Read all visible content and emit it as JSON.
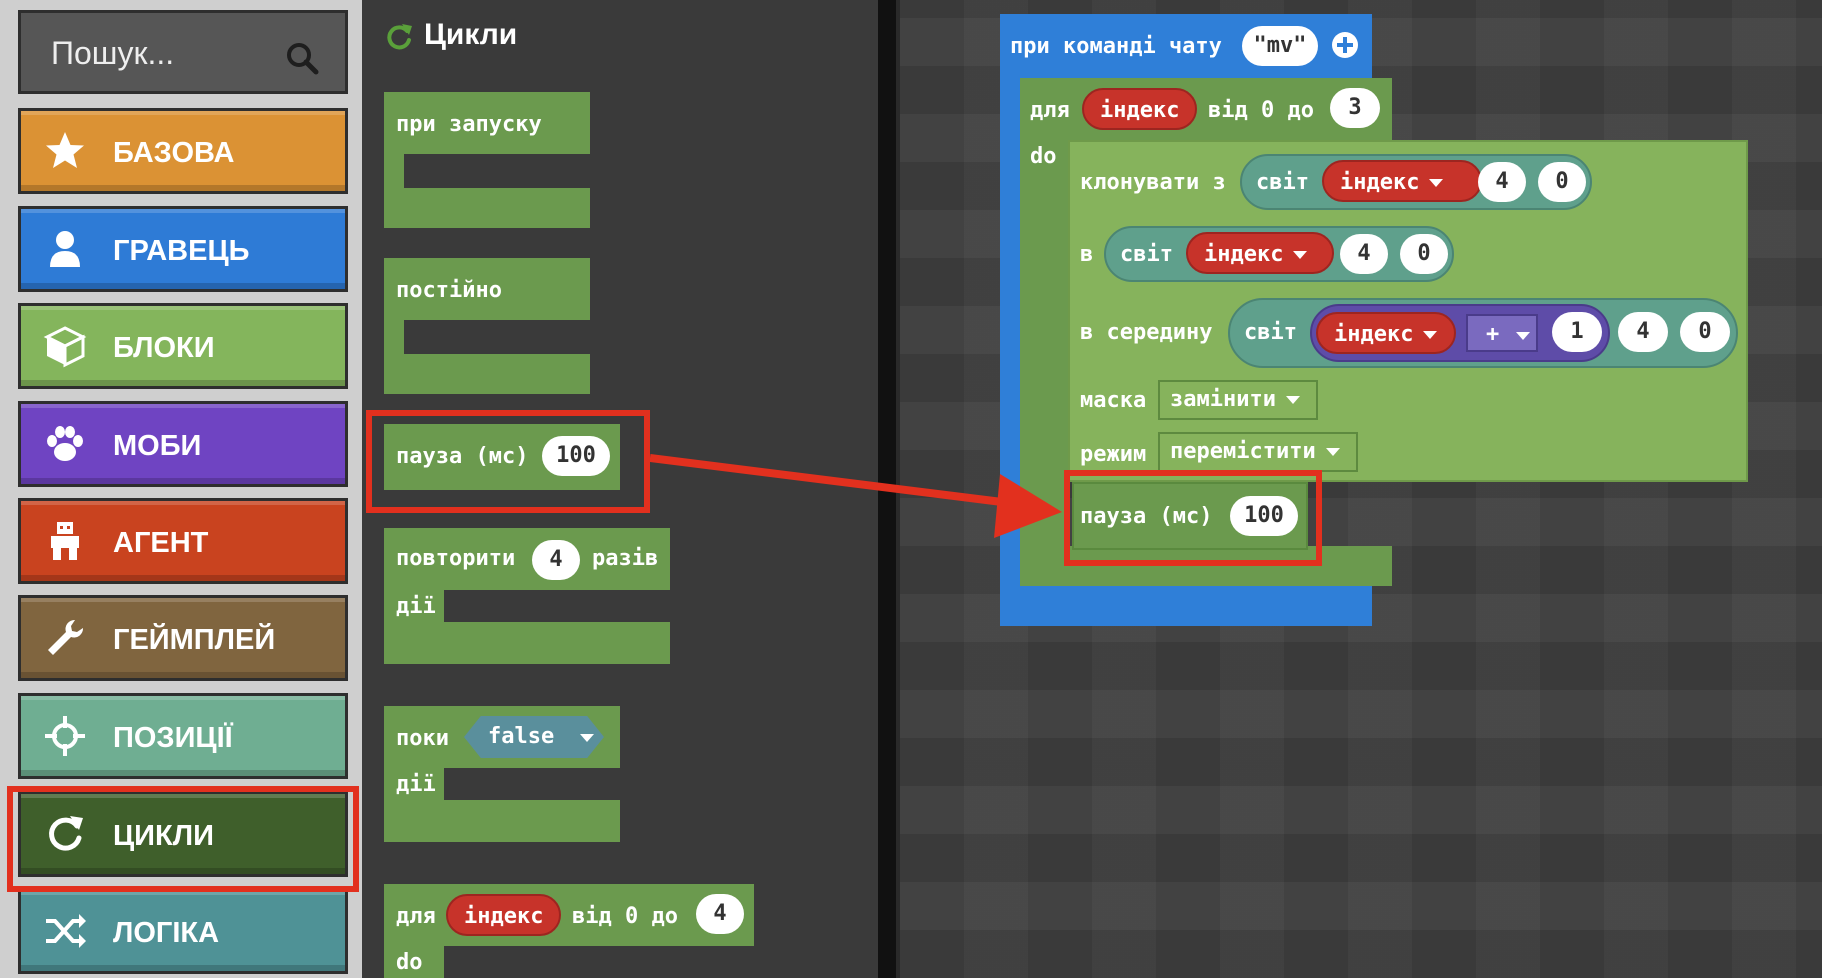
{
  "search": {
    "placeholder": "Пошук..."
  },
  "toolbox": {
    "categories": [
      {
        "label": "БАЗОВА",
        "icon": "star-icon",
        "color": "#db9234"
      },
      {
        "label": "ГРАВЕЦЬ",
        "icon": "person-icon",
        "color": "#2e7bd6"
      },
      {
        "label": "БЛОКИ",
        "icon": "cube-icon",
        "color": "#84b55c"
      },
      {
        "label": "МОБИ",
        "icon": "paw-icon",
        "color": "#6f44c2"
      },
      {
        "label": "АГЕНТ",
        "icon": "agent-icon",
        "color": "#c9431f"
      },
      {
        "label": "ГЕЙМПЛЕЙ",
        "icon": "wrench-icon",
        "color": "#80653f"
      },
      {
        "label": "ПОЗИЦІЇ",
        "icon": "crosshair-icon",
        "color": "#6fae92"
      },
      {
        "label": "ЦИКЛИ",
        "icon": "loop-icon",
        "color": "#3f5f2b",
        "selected": true
      },
      {
        "label": "ЛОГІКА",
        "icon": "shuffle-icon",
        "color": "#4f9296"
      }
    ]
  },
  "flyout": {
    "title": "Цикли",
    "on_start": "при запуску",
    "forever": "постійно",
    "pause": {
      "label": "пауза (мс)",
      "value": "100"
    },
    "repeat": {
      "label": "повторити",
      "value": "4",
      "suffix": "разів",
      "do": "дії"
    },
    "while": {
      "label": "поки",
      "value": "false",
      "do": "дії"
    },
    "for": {
      "label": "для",
      "var": "індекс",
      "from": "від 0 до",
      "value": "4",
      "do": "do"
    }
  },
  "workspace": {
    "on_chat": {
      "label": "при команді чату",
      "value": "\"mv\""
    },
    "for": {
      "label": "для",
      "var": "індекс",
      "from": "від 0 до",
      "value": "3",
      "do": "do"
    },
    "clone": {
      "label": "клонувати з",
      "world": "світ",
      "var": "індекс",
      "v1": "4",
      "v2": "0"
    },
    "into": {
      "label": "в",
      "world": "світ",
      "var": "індекс",
      "v1": "4",
      "v2": "0"
    },
    "middle": {
      "label": "в середину",
      "world": "світ",
      "var": "індекс",
      "op": "+",
      "addend": "1",
      "v1": "4",
      "v2": "0"
    },
    "mask": {
      "label": "маска",
      "value": "замінити"
    },
    "mode": {
      "label": "режим",
      "value": "перемістити"
    },
    "pause": {
      "label": "пауза (мс)",
      "value": "100"
    }
  },
  "colors": {
    "highlight": "#e2301e",
    "loops_green": "#6b9a4e",
    "minecraft_green": "#86b35c",
    "events_blue": "#2f7fd8",
    "variable_red": "#c7332a",
    "world_teal": "#5fa08c"
  }
}
